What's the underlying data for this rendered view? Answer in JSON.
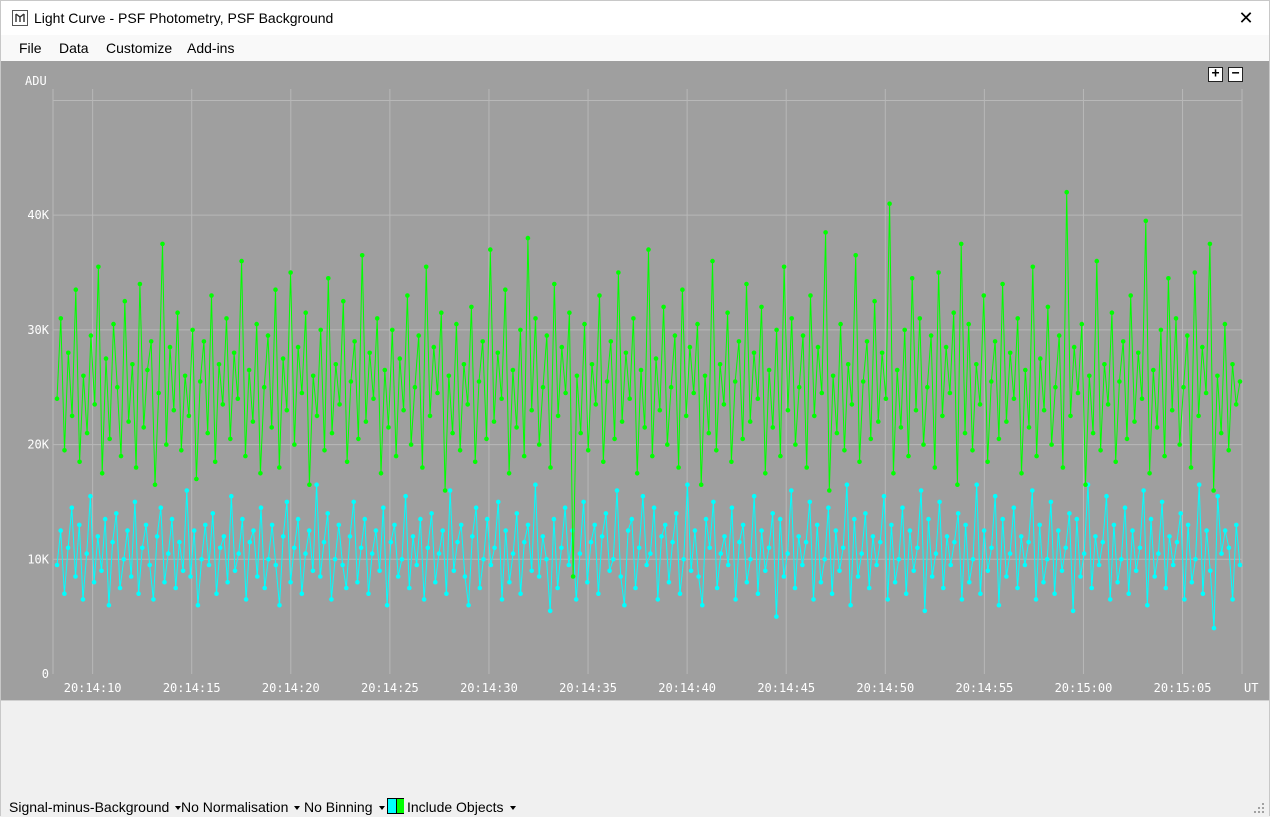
{
  "window": {
    "title": "Light Curve - PSF Photometry, PSF Background",
    "close_label": "✕"
  },
  "menu": {
    "items": [
      {
        "label": "File"
      },
      {
        "label": "Data"
      },
      {
        "label": "Customize"
      },
      {
        "label": "Add-ins"
      }
    ]
  },
  "plot": {
    "zoom_in_label": "+",
    "zoom_out_label": "−"
  },
  "chart_data": {
    "type": "line",
    "ylabel": "ADU",
    "xlabel": "UT",
    "ylim": [
      0,
      51000
    ],
    "y_ticks": [
      {
        "value": 0,
        "label": "0"
      },
      {
        "value": 10000,
        "label": "10K"
      },
      {
        "value": 20000,
        "label": "20K"
      },
      {
        "value": 30000,
        "label": "30K"
      },
      {
        "value": 40000,
        "label": "40K"
      }
    ],
    "x_ticks": [
      "20:14:10",
      "20:14:15",
      "20:14:20",
      "20:14:25",
      "20:14:30",
      "20:14:35",
      "20:14:40",
      "20:14:45",
      "20:14:50",
      "20:14:55",
      "20:15:00",
      "20:15:05"
    ],
    "x_range": [
      "20:14:08",
      "20:15:08"
    ],
    "grid": true,
    "background": "#9f9f9f",
    "series": [
      {
        "color": "#00ff00",
        "values": [
          24000,
          31000,
          19500,
          28000,
          22500,
          33500,
          18500,
          26000,
          21000,
          29500,
          23500,
          35500,
          17500,
          27500,
          20500,
          30500,
          25000,
          19000,
          32500,
          22000,
          27000,
          18000,
          34000,
          21500,
          26500,
          29000,
          16500,
          24500,
          37500,
          20000,
          28500,
          23000,
          31500,
          19500,
          26000,
          22500,
          30000,
          17000,
          25500,
          29000,
          21000,
          33000,
          18500,
          27000,
          23500,
          31000,
          20500,
          28000,
          24000,
          36000,
          19000,
          26500,
          22000,
          30500,
          17500,
          25000,
          29500,
          21500,
          33500,
          18000,
          27500,
          23000,
          35000,
          20000,
          28500,
          24500,
          31500,
          16500,
          26000,
          22500,
          30000,
          19500,
          34500,
          21000,
          27000,
          23500,
          32500,
          18500,
          25500,
          29000,
          20500,
          36500,
          22000,
          28000,
          24000,
          31000,
          17500,
          26500,
          21500,
          30000,
          19000,
          27500,
          23000,
          33000,
          20000,
          25000,
          29500,
          18000,
          35500,
          22500,
          28500,
          24500,
          31500,
          16000,
          26000,
          21000,
          30500,
          19500,
          27000,
          23500,
          32000,
          18500,
          25500,
          29000,
          20500,
          37000,
          22000,
          28000,
          24000,
          33500,
          17500,
          26500,
          21500,
          30000,
          19000,
          38000,
          23000,
          31000,
          20000,
          25000,
          29500,
          18000,
          34000,
          22500,
          28500,
          24500,
          31500,
          8500,
          26000,
          21000,
          30500,
          19500,
          27000,
          23500,
          33000,
          18500,
          25500,
          29000,
          20500,
          35000,
          22000,
          28000,
          24000,
          31000,
          17500,
          26500,
          21500,
          37000,
          19000,
          27500,
          23000,
          32000,
          20000,
          25000,
          29500,
          18000,
          33500,
          22500,
          28500,
          24500,
          30500,
          16500,
          26000,
          21000,
          36000,
          19500,
          27000,
          23500,
          31500,
          18500,
          25500,
          29000,
          20500,
          34000,
          22000,
          28000,
          24000,
          32000,
          17500,
          26500,
          21500,
          30000,
          19000,
          35500,
          23000,
          31000,
          20000,
          25000,
          29500,
          18000,
          33000,
          22500,
          28500,
          24500,
          38500,
          16000,
          26000,
          21000,
          30500,
          19500,
          27000,
          23500,
          36500,
          18500,
          25500,
          29000,
          20500,
          32500,
          22000,
          28000,
          24000,
          41000,
          17500,
          26500,
          21500,
          30000,
          19000,
          34500,
          23000,
          31000,
          20000,
          25000,
          29500,
          18000,
          35000,
          22500,
          28500,
          24500,
          31500,
          16500,
          37500,
          21000,
          30500,
          19500,
          27000,
          23500,
          33000,
          18500,
          25500,
          29000,
          20500,
          34000,
          22000,
          28000,
          24000,
          31000,
          17500,
          26500,
          21500,
          35500,
          19000,
          27500,
          23000,
          32000,
          20000,
          25000,
          29500,
          18000,
          42000,
          22500,
          28500,
          24500,
          30500,
          16500,
          26000,
          21000,
          36000,
          19500,
          27000,
          23500,
          31500,
          18500,
          25500,
          29000,
          20500,
          33000,
          22000,
          28000,
          24000,
          39500,
          17500,
          26500,
          21500,
          30000,
          19000,
          34500,
          23000,
          31000,
          20000,
          25000,
          29500,
          18000,
          35000,
          22500,
          28500,
          24500,
          37500,
          16000,
          26000,
          21000,
          30500,
          19500,
          27000,
          23500,
          25500
        ]
      },
      {
        "color": "#00ffff",
        "values": [
          9500,
          12500,
          7000,
          11000,
          14500,
          8500,
          13000,
          6500,
          10500,
          15500,
          8000,
          12000,
          9000,
          13500,
          6000,
          11500,
          14000,
          7500,
          10000,
          12500,
          8500,
          15000,
          7000,
          11000,
          13000,
          9500,
          6500,
          12000,
          14500,
          8000,
          10500,
          13500,
          7500,
          11500,
          9000,
          16000,
          8500,
          12500,
          6000,
          10000,
          13000,
          9500,
          14000,
          7000,
          11000,
          12000,
          8000,
          15500,
          9000,
          10500,
          13500,
          6500,
          11500,
          12500,
          8500,
          14500,
          7500,
          10000,
          13000,
          9500,
          6000,
          12000,
          15000,
          8000,
          11000,
          13500,
          7000,
          10500,
          12500,
          9000,
          16500,
          8500,
          11500,
          14000,
          6500,
          10000,
          13000,
          9500,
          7500,
          12000,
          15000,
          8000,
          11000,
          13500,
          7000,
          10500,
          12500,
          9000,
          14500,
          6000,
          11500,
          13000,
          8500,
          10000,
          15500,
          7500,
          12000,
          9500,
          13500,
          6500,
          11000,
          14000,
          8000,
          10500,
          12500,
          7000,
          16000,
          9000,
          11500,
          13000,
          8500,
          6000,
          12000,
          14500,
          7500,
          10000,
          13500,
          9500,
          11000,
          15000,
          6500,
          12500,
          8000,
          10500,
          14000,
          7000,
          11500,
          13000,
          9000,
          16500,
          8500,
          12000,
          10000,
          5500,
          13500,
          7500,
          11000,
          14500,
          9500,
          12500,
          6500,
          10500,
          15000,
          8000,
          11500,
          13000,
          7000,
          12000,
          14000,
          9000,
          10000,
          16000,
          8500,
          6000,
          12500,
          13500,
          7500,
          11000,
          15500,
          9500,
          10500,
          14500,
          6500,
          12000,
          13000,
          8000,
          11500,
          14000,
          7000,
          10000,
          16500,
          9000,
          12500,
          8500,
          6000,
          13500,
          11000,
          15000,
          7500,
          10500,
          12000,
          9500,
          14500,
          6500,
          11500,
          13000,
          8000,
          10000,
          15500,
          7000,
          12500,
          9000,
          11000,
          14000,
          5000,
          13500,
          8500,
          10500,
          16000,
          7500,
          12000,
          9500,
          11500,
          15000,
          6500,
          13000,
          8000,
          10000,
          14500,
          7000,
          12500,
          9000,
          11000,
          16500,
          6000,
          13500,
          8500,
          10500,
          14000,
          7500,
          12000,
          9500,
          11500,
          15500,
          6500,
          13000,
          8000,
          10000,
          14500,
          7000,
          12500,
          9000,
          11000,
          16000,
          5500,
          13500,
          8500,
          10500,
          15000,
          7500,
          12000,
          9500,
          11500,
          14000,
          6500,
          13000,
          8000,
          10000,
          16500,
          7000,
          12500,
          9000,
          11000,
          15500,
          6000,
          13500,
          8500,
          10500,
          14500,
          7500,
          12000,
          9500,
          11500,
          16000,
          6500,
          13000,
          8000,
          10000,
          15000,
          7000,
          12500,
          9000,
          11000,
          14000,
          5500,
          13500,
          8500,
          10500,
          16500,
          7500,
          12000,
          9500,
          11500,
          15500,
          6500,
          13000,
          8000,
          10000,
          14500,
          7000,
          12500,
          9000,
          11000,
          16000,
          6000,
          13500,
          8500,
          10500,
          15000,
          7500,
          12000,
          9500,
          11500,
          14000,
          6500,
          13000,
          8000,
          10000,
          16500,
          7000,
          12500,
          9000,
          4000,
          15500,
          10500,
          12500,
          11000,
          6500,
          13000,
          9500
        ]
      }
    ]
  },
  "statusbar": {
    "measurement_label": "Signal-minus-Background",
    "normalisation_label": "No Normalisation",
    "binning_label": "No Binning",
    "objects_label": "Include Objects",
    "objects_colors": [
      "#00ffff",
      "#00ff00"
    ]
  }
}
